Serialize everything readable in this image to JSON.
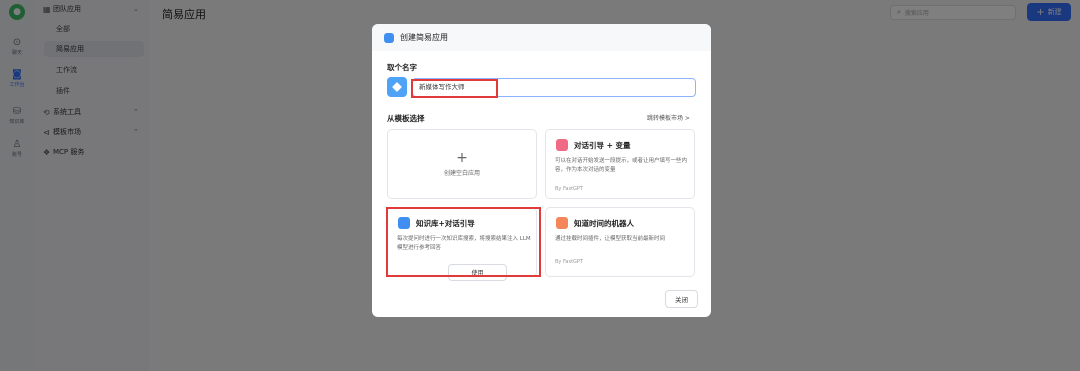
{
  "rail": {
    "items": [
      {
        "icon": "chat-icon",
        "glyph": "⊙",
        "label": "聊天"
      },
      {
        "icon": "robot-icon",
        "glyph": "🤖",
        "label": "工作台"
      },
      {
        "icon": "database-icon",
        "glyph": "⛁",
        "label": "知识库"
      },
      {
        "icon": "user-icon",
        "glyph": "♙",
        "label": "账号"
      }
    ]
  },
  "sidebar": {
    "group_team": "团队应用",
    "team_items": [
      "全部",
      "简易应用",
      "工作流",
      "插件"
    ],
    "group_tools": "系统工具",
    "group_market": "模板市场",
    "group_mcp": "MCP 服务"
  },
  "main": {
    "title": "简易应用",
    "search_placeholder": "搜索应用",
    "new_label": "新建"
  },
  "modal": {
    "title": "创建简易应用",
    "name_label": "取个名字",
    "name_value": "新媒体写作大师",
    "template_label": "从模板选择",
    "template_link": "跳转模板市场 >",
    "blank_label": "创建空白应用",
    "cards": [
      {
        "title": "对话引导 + 变量",
        "desc": "可以在对话开始发送一段提示，或者让用户填写一些内容，作为本次对话的变量",
        "by": "By FastGPT",
        "icon_color": "#f06a86"
      },
      {
        "title": "知识库+对话引导",
        "desc": "每次提问时进行一次知识库搜索，将搜索结果注入 LLM 模型进行参考回答",
        "use": "使用",
        "icon_color": "#3f8ef0"
      },
      {
        "title": "知道时间的机器人",
        "desc": "通过挂载时间插件，让模型获取当前最新时间",
        "by": "By FastGPT",
        "icon_color": "#f5865a"
      }
    ],
    "close_label": "关闭"
  },
  "colors": {
    "accent": "#3370ff",
    "highlight": "#e03a3a"
  }
}
